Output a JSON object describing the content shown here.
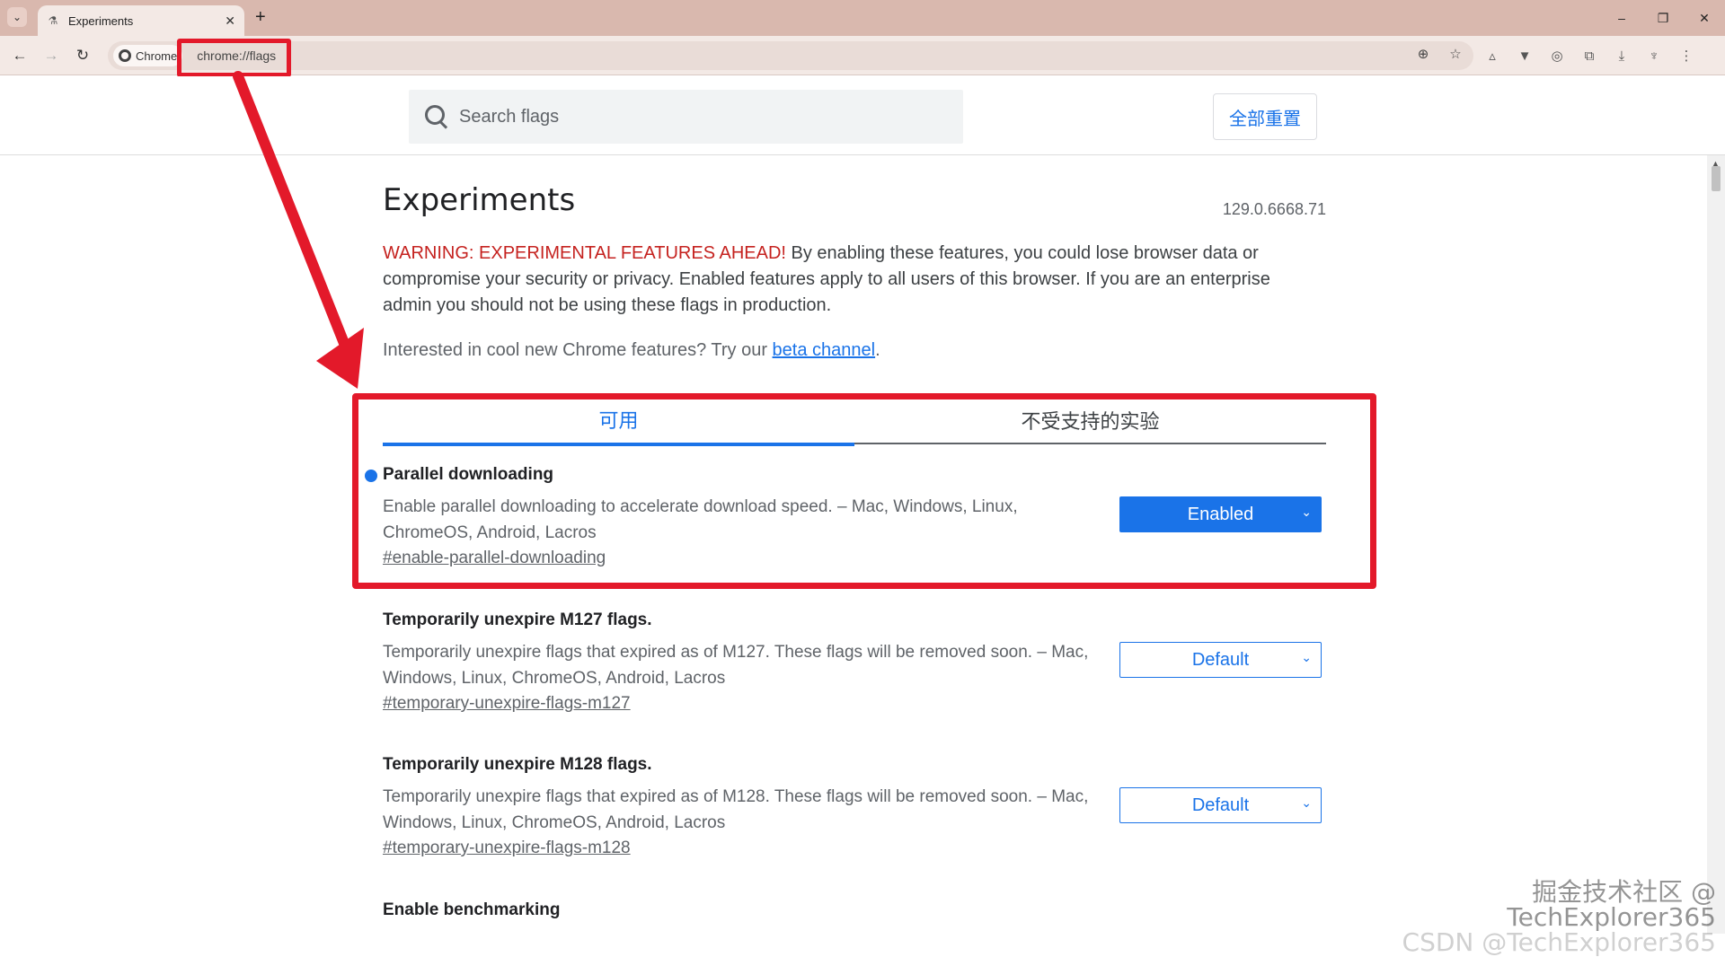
{
  "browser": {
    "tab_title": "Experiments",
    "tab_close": "✕",
    "new_tab": "+",
    "site_chip": "Chrome",
    "url": "chrome://flags",
    "win_minimize": "–",
    "win_restore": "❐",
    "win_close": "✕"
  },
  "header": {
    "search_placeholder": "Search flags",
    "reset_all": "全部重置"
  },
  "page": {
    "title": "Experiments",
    "version": "129.0.6668.71",
    "warning_strong": "WARNING: EXPERIMENTAL FEATURES AHEAD!",
    "warning_rest": " By enabling these features, you could lose browser data or compromise your security or privacy. Enabled features apply to all users of this browser. If you are an enterprise admin you should not be using these flags in production.",
    "interest_text": "Interested in cool new Chrome features? Try our ",
    "beta_link": "beta channel",
    "interest_end": "."
  },
  "tabs": {
    "available": "可用",
    "unavailable": "不受支持的实验"
  },
  "flags": [
    {
      "name": "Parallel downloading",
      "description": "Enable parallel downloading to accelerate download speed. – Mac, Windows, Linux, ChromeOS, Android, Lacros",
      "link": "#enable-parallel-downloading",
      "value": "Enabled"
    },
    {
      "name": "Temporarily unexpire M127 flags.",
      "description": "Temporarily unexpire flags that expired as of M127. These flags will be removed soon. – Mac, Windows, Linux, ChromeOS, Android, Lacros",
      "link": "#temporary-unexpire-flags-m127",
      "value": "Default"
    },
    {
      "name": "Temporarily unexpire M128 flags.",
      "description": "Temporarily unexpire flags that expired as of M128. These flags will be removed soon. – Mac, Windows, Linux, ChromeOS, Android, Lacros",
      "link": "#temporary-unexpire-flags-m128",
      "value": "Default"
    },
    {
      "name": "Enable benchmarking"
    }
  ],
  "watermark": {
    "line1": "掘金技术社区 @ TechExplorer365",
    "line2": "CSDN @TechExplorer365"
  },
  "colors": {
    "accent": "#1a73e8",
    "annotation_red": "#e3192a",
    "warning_red": "#c5221f"
  }
}
